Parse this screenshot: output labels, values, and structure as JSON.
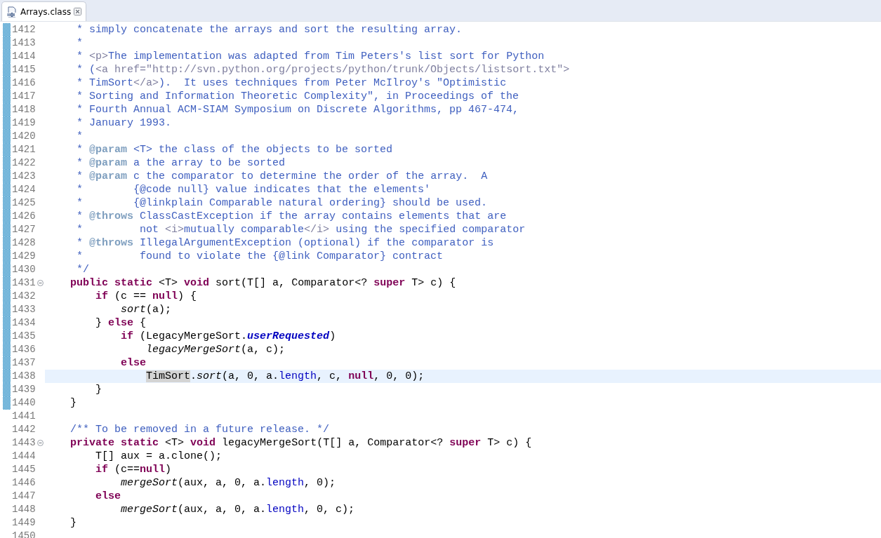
{
  "tabs": [
    {
      "label": "Arrays.class",
      "selected": true
    }
  ],
  "editor": {
    "lines": [
      {
        "number": "1412",
        "changed": true,
        "tokens": [
          {
            "text": "     * simply concatenate the arrays and sort the resulting array.",
            "kind": "doc"
          }
        ]
      },
      {
        "number": "1413",
        "changed": true,
        "tokens": [
          {
            "text": "     *",
            "kind": "doc"
          }
        ]
      },
      {
        "number": "1414",
        "changed": true,
        "tokens": [
          {
            "text": "     * ",
            "kind": "doc"
          },
          {
            "text": "<p>",
            "kind": "dochtml"
          },
          {
            "text": "The implementation was adapted from Tim Peters's list sort for Python",
            "kind": "doc"
          }
        ]
      },
      {
        "number": "1415",
        "changed": true,
        "tokens": [
          {
            "text": "     * (",
            "kind": "doc"
          },
          {
            "text": "<a href=\"http://svn.python.org/projects/python/trunk/Objects/listsort.txt\">",
            "kind": "dochtml"
          }
        ]
      },
      {
        "number": "1416",
        "changed": true,
        "tokens": [
          {
            "text": "     * TimSort",
            "kind": "doc"
          },
          {
            "text": "</a>",
            "kind": "dochtml"
          },
          {
            "text": ").  It uses techniques from Peter McIlroy's \"Optimistic",
            "kind": "doc"
          }
        ]
      },
      {
        "number": "1417",
        "changed": true,
        "tokens": [
          {
            "text": "     * Sorting and Information Theoretic Complexity\", in Proceedings of the",
            "kind": "doc"
          }
        ]
      },
      {
        "number": "1418",
        "changed": true,
        "tokens": [
          {
            "text": "     * Fourth Annual ACM-SIAM Symposium on Discrete Algorithms, pp 467-474,",
            "kind": "doc"
          }
        ]
      },
      {
        "number": "1419",
        "changed": true,
        "tokens": [
          {
            "text": "     * January 1993.",
            "kind": "doc"
          }
        ]
      },
      {
        "number": "1420",
        "changed": true,
        "tokens": [
          {
            "text": "     *",
            "kind": "doc"
          }
        ]
      },
      {
        "number": "1421",
        "changed": true,
        "tokens": [
          {
            "text": "     * ",
            "kind": "doc"
          },
          {
            "text": "@param",
            "kind": "doctag"
          },
          {
            "text": " <T> the class of the objects to be sorted",
            "kind": "doc"
          }
        ]
      },
      {
        "number": "1422",
        "changed": true,
        "tokens": [
          {
            "text": "     * ",
            "kind": "doc"
          },
          {
            "text": "@param",
            "kind": "doctag"
          },
          {
            "text": " a the array to be sorted",
            "kind": "doc"
          }
        ]
      },
      {
        "number": "1423",
        "changed": true,
        "tokens": [
          {
            "text": "     * ",
            "kind": "doc"
          },
          {
            "text": "@param",
            "kind": "doctag"
          },
          {
            "text": " c the comparator to determine the order of the array.  A",
            "kind": "doc"
          }
        ]
      },
      {
        "number": "1424",
        "changed": true,
        "tokens": [
          {
            "text": "     *        {@code null} value indicates that the elements'",
            "kind": "doc"
          }
        ]
      },
      {
        "number": "1425",
        "changed": true,
        "tokens": [
          {
            "text": "     *        {@linkplain Comparable natural ordering} should be used.",
            "kind": "doc"
          }
        ]
      },
      {
        "number": "1426",
        "changed": true,
        "tokens": [
          {
            "text": "     * ",
            "kind": "doc"
          },
          {
            "text": "@throws",
            "kind": "doctag"
          },
          {
            "text": " ClassCastException if the array contains elements that are",
            "kind": "doc"
          }
        ]
      },
      {
        "number": "1427",
        "changed": true,
        "tokens": [
          {
            "text": "     *         not ",
            "kind": "doc"
          },
          {
            "text": "<i>",
            "kind": "dochtml"
          },
          {
            "text": "mutually comparable",
            "kind": "doc"
          },
          {
            "text": "</i>",
            "kind": "dochtml"
          },
          {
            "text": " using the specified comparator",
            "kind": "doc"
          }
        ]
      },
      {
        "number": "1428",
        "changed": true,
        "tokens": [
          {
            "text": "     * ",
            "kind": "doc"
          },
          {
            "text": "@throws",
            "kind": "doctag"
          },
          {
            "text": " IllegalArgumentException (optional) if the comparator is",
            "kind": "doc"
          }
        ]
      },
      {
        "number": "1429",
        "changed": true,
        "tokens": [
          {
            "text": "     *         found to violate the {@link Comparator} contract",
            "kind": "doc"
          }
        ]
      },
      {
        "number": "1430",
        "changed": true,
        "tokens": [
          {
            "text": "     */",
            "kind": "doc"
          }
        ]
      },
      {
        "number": "1431",
        "changed": true,
        "foldable": true,
        "tokens": [
          {
            "text": "    public static",
            "kind": "keyword"
          },
          {
            "text": " <T> ",
            "kind": "plain"
          },
          {
            "text": "void",
            "kind": "keyword"
          },
          {
            "text": " sort(T[] a, Comparator<? ",
            "kind": "plain"
          },
          {
            "text": "super",
            "kind": "keyword"
          },
          {
            "text": " T> c) {",
            "kind": "plain"
          }
        ]
      },
      {
        "number": "1432",
        "changed": true,
        "tokens": [
          {
            "text": "        if",
            "kind": "keyword"
          },
          {
            "text": " (c == ",
            "kind": "plain"
          },
          {
            "text": "null",
            "kind": "keyword"
          },
          {
            "text": ") {",
            "kind": "plain"
          }
        ]
      },
      {
        "number": "1433",
        "changed": true,
        "tokens": [
          {
            "text": "            sort",
            "kind": "method"
          },
          {
            "text": "(a);",
            "kind": "plain"
          }
        ]
      },
      {
        "number": "1434",
        "changed": true,
        "tokens": [
          {
            "text": "        } ",
            "kind": "plain"
          },
          {
            "text": "else",
            "kind": "keyword"
          },
          {
            "text": " {",
            "kind": "plain"
          }
        ]
      },
      {
        "number": "1435",
        "changed": true,
        "tokens": [
          {
            "text": "            if",
            "kind": "keyword"
          },
          {
            "text": " (LegacyMergeSort.",
            "kind": "plain"
          },
          {
            "text": "userRequested",
            "kind": "static-field"
          },
          {
            "text": ")",
            "kind": "plain"
          }
        ]
      },
      {
        "number": "1436",
        "changed": true,
        "tokens": [
          {
            "text": "                legacyMergeSort",
            "kind": "method"
          },
          {
            "text": "(a, c);",
            "kind": "plain"
          }
        ]
      },
      {
        "number": "1437",
        "changed": true,
        "tokens": [
          {
            "text": "            else",
            "kind": "keyword"
          }
        ]
      },
      {
        "number": "1438",
        "changed": true,
        "current": true,
        "tokens": [
          {
            "text": "                TimSort",
            "kind": "occurrence"
          },
          {
            "text": ".",
            "kind": "plain"
          },
          {
            "text": "sort",
            "kind": "method"
          },
          {
            "text": "(a, 0, a.",
            "kind": "plain"
          },
          {
            "text": "length",
            "kind": "field"
          },
          {
            "text": ", c, ",
            "kind": "plain"
          },
          {
            "text": "null",
            "kind": "keyword"
          },
          {
            "text": ", 0, 0);",
            "kind": "plain"
          }
        ]
      },
      {
        "number": "1439",
        "changed": true,
        "tokens": [
          {
            "text": "        }",
            "kind": "plain"
          }
        ]
      },
      {
        "number": "1440",
        "changed": true,
        "tokens": [
          {
            "text": "    }",
            "kind": "plain"
          }
        ]
      },
      {
        "number": "1441",
        "changed": false
      },
      {
        "number": "1442",
        "changed": false,
        "tokens": [
          {
            "text": "    /** To be removed in a future release. */",
            "kind": "doc"
          }
        ]
      },
      {
        "number": "1443",
        "changed": false,
        "foldable": true,
        "tokens": [
          {
            "text": "    private static",
            "kind": "keyword"
          },
          {
            "text": " <T> ",
            "kind": "plain"
          },
          {
            "text": "void",
            "kind": "keyword"
          },
          {
            "text": " legacyMergeSort(T[] a, Comparator<? ",
            "kind": "plain"
          },
          {
            "text": "super",
            "kind": "keyword"
          },
          {
            "text": " T> c) {",
            "kind": "plain"
          }
        ]
      },
      {
        "number": "1444",
        "changed": false,
        "tokens": [
          {
            "text": "        T[] aux = a.clone();",
            "kind": "plain"
          }
        ]
      },
      {
        "number": "1445",
        "changed": false,
        "tokens": [
          {
            "text": "        if",
            "kind": "keyword"
          },
          {
            "text": " (c==",
            "kind": "plain"
          },
          {
            "text": "null",
            "kind": "keyword"
          },
          {
            "text": ")",
            "kind": "plain"
          }
        ]
      },
      {
        "number": "1446",
        "changed": false,
        "tokens": [
          {
            "text": "            mergeSort",
            "kind": "method"
          },
          {
            "text": "(aux, a, 0, a.",
            "kind": "plain"
          },
          {
            "text": "length",
            "kind": "field"
          },
          {
            "text": ", 0);",
            "kind": "plain"
          }
        ]
      },
      {
        "number": "1447",
        "changed": false,
        "tokens": [
          {
            "text": "        else",
            "kind": "keyword"
          }
        ]
      },
      {
        "number": "1448",
        "changed": false,
        "tokens": [
          {
            "text": "            mergeSort",
            "kind": "method"
          },
          {
            "text": "(aux, a, 0, a.",
            "kind": "plain"
          },
          {
            "text": "length",
            "kind": "field"
          },
          {
            "text": ", 0, c);",
            "kind": "plain"
          }
        ]
      },
      {
        "number": "1449",
        "changed": false,
        "tokens": [
          {
            "text": "    }",
            "kind": "plain"
          }
        ]
      },
      {
        "number": "1450",
        "changed": false
      }
    ]
  }
}
